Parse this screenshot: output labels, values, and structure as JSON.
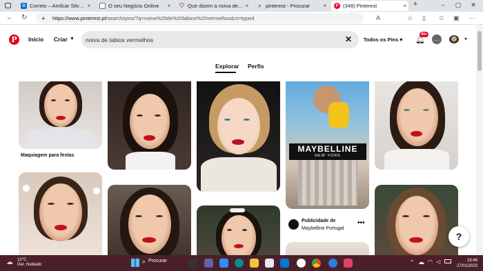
{
  "browser": {
    "tabs": [
      {
        "label": "Correio – Amilcar Silva – Out",
        "icon": "outlook-icon",
        "color": "#0f6cbd"
      },
      {
        "label": "O seu Negócio Online",
        "icon": "globe-icon",
        "color": "#5f6368"
      },
      {
        "label": "Que dizem a noiva de lábios",
        "icon": "heart-icon",
        "color": "#c2185b"
      },
      {
        "label": "pinterest - Procurar",
        "icon": "search-icon",
        "color": "#1a73e8"
      },
      {
        "label": "(348) Pinterest",
        "icon": "pinterest-icon",
        "color": "#e60023"
      }
    ],
    "url_host": "https://www.pinterest.pt",
    "url_path": "/search/pins/?q=noiva%20de%20labios%20vermelhos&rs=typed"
  },
  "pinterest": {
    "logo": "P",
    "nav": {
      "home": "Início",
      "create": "Criar"
    },
    "search_value": "noiva de labios vermelhos",
    "scope": "Todos os Pins",
    "notifications": "99+",
    "tabs": {
      "explore": "Explorar",
      "profiles": "Perfis"
    },
    "pins": {
      "caption1": "Maquiagem para festas",
      "ad_title": "Publicidade de",
      "ad_brand": "Maybelline Portugal",
      "ad_logo": "MAYBELLINE",
      "ad_logo_sub": "NEW YORK"
    },
    "help": "?"
  },
  "taskbar": {
    "temp": "12°C",
    "weather": "Ger. Nublado",
    "search": "Procurar",
    "time": "18:46",
    "date": "27/01/2023"
  },
  "colors": {
    "brand": "#e60023",
    "taskbar": "#4b1f2a"
  }
}
